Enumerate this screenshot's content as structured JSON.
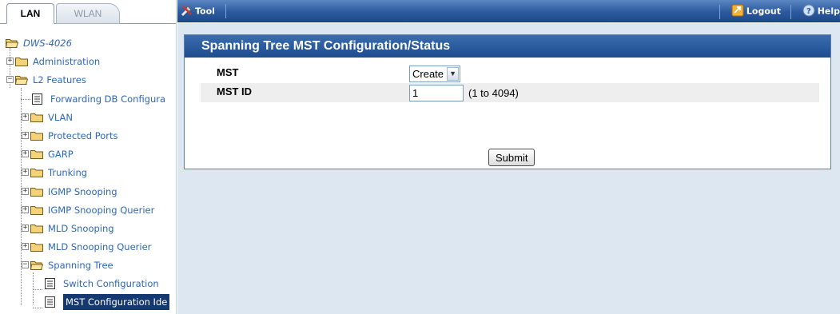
{
  "tabs": [
    {
      "label": "LAN",
      "active": true
    },
    {
      "label": "WLAN",
      "active": false
    }
  ],
  "tree": {
    "root": "DWS-4026",
    "items": [
      {
        "label": "Administration",
        "type": "folder",
        "expanded": false
      },
      {
        "label": "L2 Features",
        "type": "folder",
        "expanded": true
      },
      {
        "label": "Forwarding DB Configura",
        "type": "page"
      },
      {
        "label": "VLAN",
        "type": "folder",
        "expanded": false
      },
      {
        "label": "Protected Ports",
        "type": "folder",
        "expanded": false
      },
      {
        "label": "GARP",
        "type": "folder",
        "expanded": false
      },
      {
        "label": "Trunking",
        "type": "folder",
        "expanded": false
      },
      {
        "label": "IGMP Snooping",
        "type": "folder",
        "expanded": false
      },
      {
        "label": "IGMP Snooping Querier",
        "type": "folder",
        "expanded": false
      },
      {
        "label": "MLD Snooping",
        "type": "folder",
        "expanded": false
      },
      {
        "label": "MLD Snooping Querier",
        "type": "folder",
        "expanded": false
      },
      {
        "label": "Spanning Tree",
        "type": "folder",
        "expanded": true
      },
      {
        "label": "Switch Configuration",
        "type": "page"
      },
      {
        "label": "MST Configuration Ide",
        "type": "page",
        "selected": true
      }
    ]
  },
  "topbar": {
    "tool_label": "Tool",
    "logout_label": "Logout",
    "help_label": "Help"
  },
  "panel": {
    "title": "Spanning Tree MST Configuration/Status",
    "mst_label": "MST",
    "mst_value": "Create",
    "mst_id_label": "MST ID",
    "mst_id_value": "1",
    "mst_id_hint": "(1 to 4094)",
    "submit_label": "Submit"
  },
  "colors": {
    "header_blue": "#2c5a9e",
    "selected_bg": "#14386f",
    "link_blue": "#2d68b8",
    "content_bg": "#dde7f1"
  }
}
